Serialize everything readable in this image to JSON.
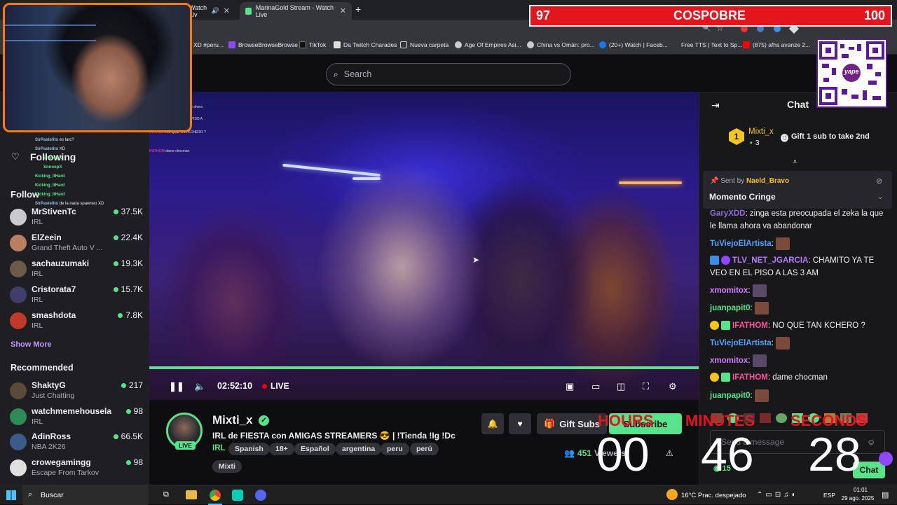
{
  "browser": {
    "tabs": [
      {
        "title": "Watch Liv"
      },
      {
        "title": "MarinaGold Stream - Watch Live"
      }
    ],
    "bookmarks": [
      {
        "label": "XD #peru..."
      },
      {
        "label": "BrowseBrowseBrowse"
      },
      {
        "label": "TikTok"
      },
      {
        "label": "Da Twitch Charades"
      },
      {
        "label": "Nueva carpeta"
      },
      {
        "label": "Age Of Empires Asi..."
      },
      {
        "label": "China vs Omán: pro..."
      },
      {
        "label": "(20+) Watch | Faceb..."
      },
      {
        "label": "Free TTS | Text to Sp..."
      },
      {
        "label": "(875) afhs avanze 2..."
      }
    ]
  },
  "search": {
    "placeholder": "Search"
  },
  "sidebar": {
    "following_label": "Following",
    "followed_label": "Follow",
    "followed": [
      {
        "name": "MrStivenTc",
        "category": "IRL",
        "viewers": "37.5K",
        "color": "#c9c9d0"
      },
      {
        "name": "ElZeein",
        "category": "Grand Theft Auto V ...",
        "viewers": "22.4K",
        "color": "#b88060"
      },
      {
        "name": "sachauzumaki",
        "category": "IRL",
        "viewers": "19.3K",
        "color": "#6d5a4a"
      },
      {
        "name": "Cristorata7",
        "category": "IRL",
        "viewers": "15.7K",
        "color": "#3e3e6a"
      },
      {
        "name": "smashdota",
        "category": "IRL",
        "viewers": "7.8K",
        "color": "#c0392b"
      }
    ],
    "show_more": "Show More",
    "recommended_label": "Recommended",
    "recommended": [
      {
        "name": "ShaktyG",
        "category": "Just Chatting",
        "viewers": "217",
        "color": "#5a4a3a"
      },
      {
        "name": "watchmemehousela",
        "category": "IRL",
        "viewers": "98",
        "color": "#2e8b57"
      },
      {
        "name": "AdinRoss",
        "category": "NBA 2K26",
        "viewers": "66.5K",
        "color": "#3b5b8a"
      },
      {
        "name": "crowegamingg",
        "category": "Escape From Tarkov",
        "viewers": "98",
        "color": "#e0e0e0"
      }
    ],
    "overlay_chat": [
      {
        "user": "SirPastelito",
        "text": "es larc?"
      },
      {
        "user": "SirPastelito",
        "text": "XD"
      },
      {
        "user": "SnnoopX",
        "text": ""
      },
      {
        "user": "SnnoopX",
        "text": ""
      },
      {
        "user": "Kicking_ItHard",
        "text": ""
      },
      {
        "user": "Kicking_ItHard",
        "text": ""
      },
      {
        "user": "Kicking_ItHard",
        "text": ""
      },
      {
        "user": "SirPastelito",
        "text": "de la nada spawneo XD"
      }
    ]
  },
  "player": {
    "time": "02:52:10",
    "live_label": "LIVE",
    "progress": 1.0,
    "mini_chat": [
      {
        "user": "",
        "text": "por capricho"
      },
      {
        "user": "",
        "text": "cada el zeka lo que le llama ahora"
      },
      {
        "user": "",
        "text": "AMITO YA TE VEO EN EL PISO A"
      },
      {
        "user": "IFATHOM",
        "text": "NO QUE TAN KCHERO ?"
      },
      {
        "user": "IFATHOM",
        "text": "dame chocman"
      }
    ]
  },
  "channel": {
    "name": "Mixti_x",
    "live_badge": "LIVE",
    "title": "IRL de FIESTA con AMIGAS STREAMERS 😎 | !Tienda !Ig !Dc",
    "category": "IRL",
    "tags": [
      "Spanish",
      "18+",
      "Español",
      "argentina",
      "peru",
      "perú"
    ],
    "extra_tag": "Mixti",
    "viewers": "451",
    "viewers_label": "Viewers",
    "gift_subs_label": "Gift Subs",
    "subscribe_label": "Subscribe"
  },
  "chat": {
    "title": "Chat",
    "leader": {
      "name": "Mixti_x",
      "count": "3",
      "rank": "1",
      "gift_cta": "Gift 1 sub to take 2nd"
    },
    "pinned": {
      "sent_by_label": "Sent by",
      "sender": "Naeld_Bravo",
      "message": "Momento Cringe"
    },
    "messages": [
      {
        "user": "GaryXDD",
        "color": "#8a6fd6",
        "text": "zinga esta preocupada el zeka la que le llama ahora va abandonar",
        "emote": false
      },
      {
        "user": "TuViejoElArtista",
        "color": "#4da3ff",
        "text": "",
        "emote": true
      },
      {
        "user": "TLV_NET_JGARCIA",
        "color": "#b57bff",
        "text": "CHAMITO YA TE VEO EN EL PISO A LAS 3 AM",
        "emote": false
      },
      {
        "user": "xmomitox",
        "color": "#d17bff",
        "text": "",
        "emote": true
      },
      {
        "user": "juanpapit0",
        "color": "#57e389",
        "text": "",
        "emote": true
      },
      {
        "user": "IFATHOM",
        "color": "#ff4f9e",
        "text": "NO QUE TAN KCHERO ?",
        "emote": false
      },
      {
        "user": "TuViejoElArtista",
        "color": "#4da3ff",
        "text": "",
        "emote": true
      },
      {
        "user": "xmomitox",
        "color": "#d17bff",
        "text": "",
        "emote": true
      },
      {
        "user": "IFATHOM",
        "color": "#ff4f9e",
        "text": "dame chocman",
        "emote": false
      },
      {
        "user": "juanpapit0",
        "color": "#57e389",
        "text": "",
        "emote": true
      }
    ],
    "input_placeholder": "Send a message",
    "points": "15",
    "send_label": "Chat"
  },
  "overlay": {
    "bar": {
      "left": "97",
      "label": "COSPOBRE",
      "right": "100"
    },
    "qr_label": "yape",
    "timer": {
      "hours_label": "HOURS",
      "minutes_label": "MINUTES",
      "seconds_label": "SECONDS",
      "hours": "00",
      "minutes": "46",
      "seconds": "28"
    }
  },
  "taskbar": {
    "search_label": "Buscar",
    "weather": "16°C  Prac. despejado",
    "lang": "ESP",
    "time": "01:01",
    "date": "29 ago. 2025"
  }
}
